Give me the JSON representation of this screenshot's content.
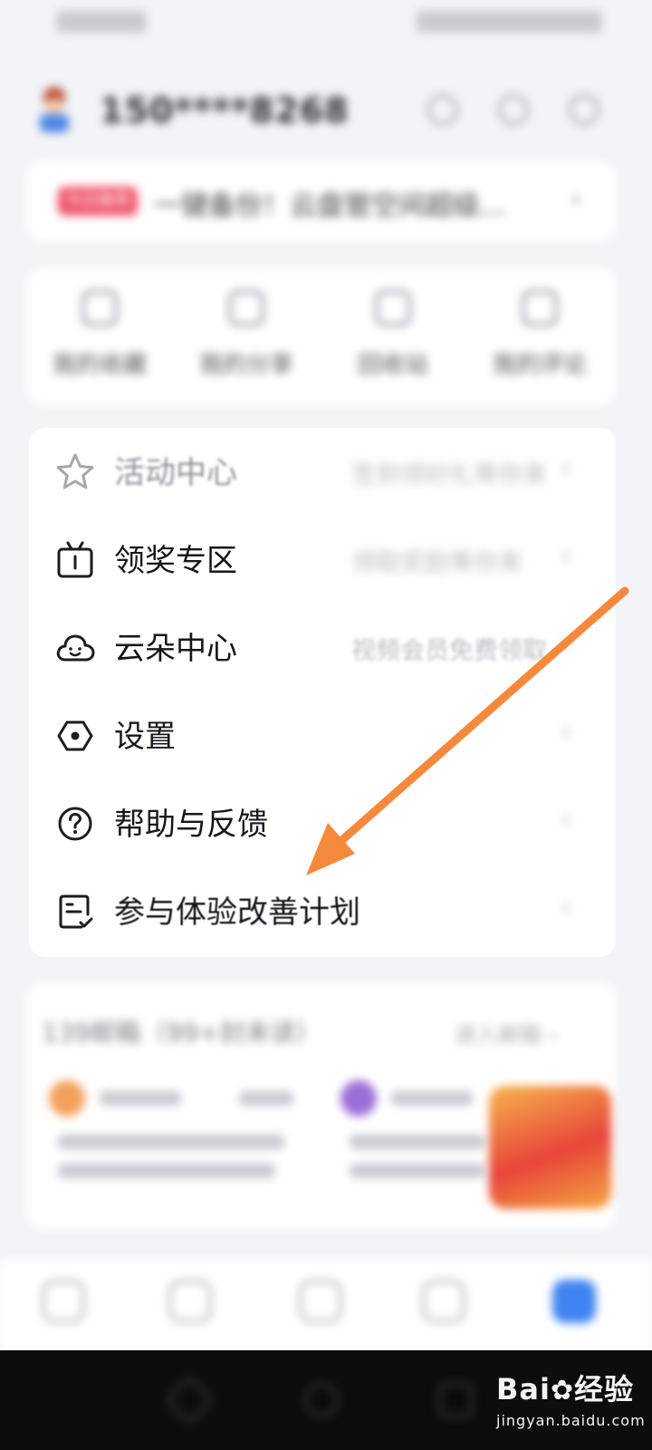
{
  "status_bar": {
    "left": "",
    "right": ""
  },
  "header": {
    "username": "150****8268"
  },
  "banner": {
    "tag": "今日推荐",
    "text": "一键备份！云盘管空间超级...",
    "chevron": "›"
  },
  "quick_actions": [
    {
      "label": "我的收藏"
    },
    {
      "label": "我的分享"
    },
    {
      "label": "回收站"
    },
    {
      "label": "我的评论"
    }
  ],
  "menu": [
    {
      "label": "活动中心",
      "sub": "签到领好礼等你来",
      "chevron": "›"
    },
    {
      "label": "领奖专区",
      "sub": "领取奖励等你来",
      "chevron": "›"
    },
    {
      "label": "云朵中心",
      "sub": "视频会员免费领取",
      "chevron": "›"
    },
    {
      "label": "设置",
      "sub": "",
      "chevron": "›"
    },
    {
      "label": "帮助与反馈",
      "sub": "",
      "chevron": "›"
    },
    {
      "label": "参与体验改善计划",
      "sub": "",
      "chevron": "›"
    }
  ],
  "mail": {
    "title": "139邮箱（99+封未读）",
    "more": "进入邮箱 ›"
  },
  "watermark": {
    "brand": "Bai",
    "brand_suffix": "经验",
    "url": "jingyan.baidu.com"
  },
  "colors": {
    "accent": "#3f84f0",
    "arrow": "#f5893b",
    "banner_tag": "#f0526a"
  }
}
